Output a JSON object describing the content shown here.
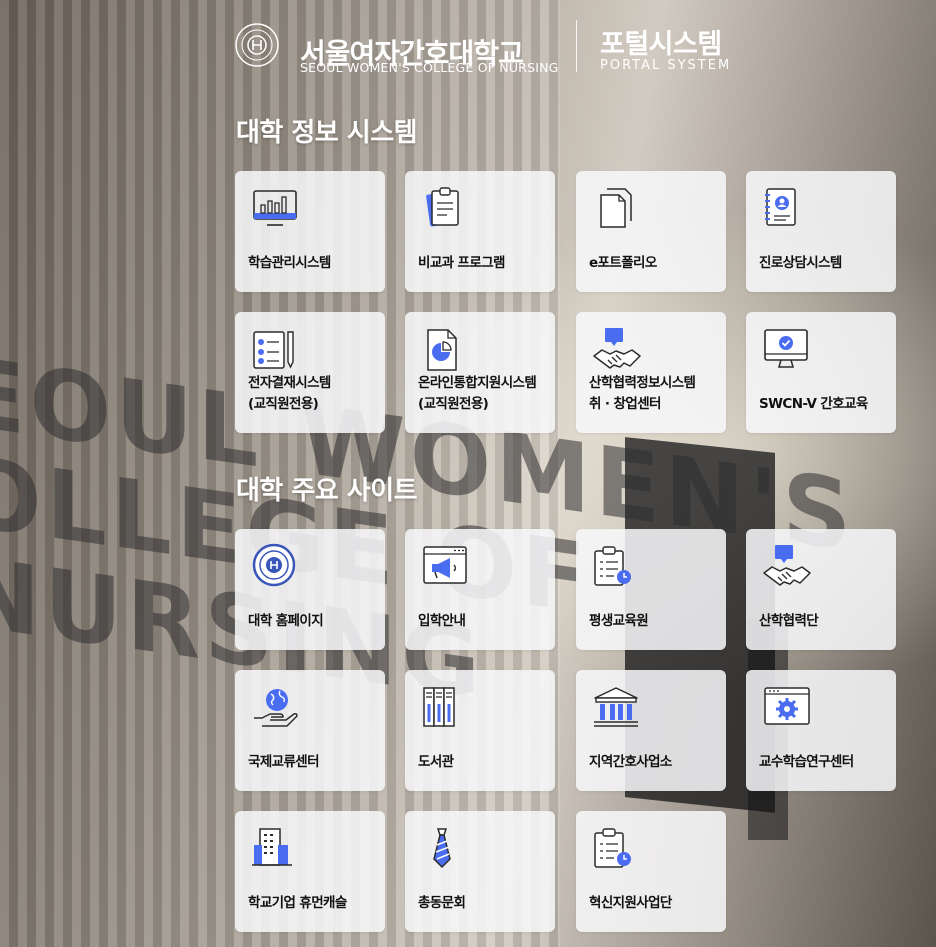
{
  "header": {
    "emblem_text": "SEOUL WOMEN'S COLLEGE OF NURSING 1936",
    "brand_ko": "서울여자간호대학교",
    "brand_en": "SEOUL WOMEN'S COLLEGE OF NURSING",
    "portal_ko": "포털시스템",
    "portal_en": "PORTAL SYSTEM"
  },
  "background": {
    "wall_lines": [
      "EOUL WOMEN'S",
      "OLLEGE OF NURSING"
    ]
  },
  "sections": [
    {
      "title": "대학 정보 시스템",
      "cards": [
        {
          "label": "학습관리시스템",
          "icon": "lms-monitor-icon"
        },
        {
          "label": "비교과 프로그램",
          "icon": "clipboard-icon"
        },
        {
          "label": "e포트폴리오",
          "icon": "documents-icon"
        },
        {
          "label": "진로상담시스템",
          "icon": "contact-book-icon"
        },
        {
          "label": "전자결재시스템\n(교직원전용)",
          "icon": "checklist-pen-icon"
        },
        {
          "label": "온라인통합지원시스템\n(교직원전용)",
          "icon": "report-chart-icon"
        },
        {
          "label": "산학협력정보시스템\n취 · 창업센터",
          "icon": "handshake-icon"
        },
        {
          "label": "SWCN-V 간호교육",
          "icon": "monitor-check-icon"
        }
      ]
    },
    {
      "title": "대학 주요 사이트",
      "cards": [
        {
          "label": "대학 홈페이지",
          "icon": "college-emblem-icon"
        },
        {
          "label": "입학안내",
          "icon": "megaphone-browser-icon"
        },
        {
          "label": "평생교육원",
          "icon": "clipboard-clock-icon"
        },
        {
          "label": "산학협력단",
          "icon": "handshake-icon"
        },
        {
          "label": "국제교류센터",
          "icon": "globe-hand-icon"
        },
        {
          "label": "도서관",
          "icon": "books-icon"
        },
        {
          "label": "지역간호사업소",
          "icon": "institution-icon"
        },
        {
          "label": "교수학습연구센터",
          "icon": "gear-browser-icon"
        },
        {
          "label": "학교기업 휴먼캐슬",
          "icon": "building-icon"
        },
        {
          "label": "총동문회",
          "icon": "necktie-icon"
        },
        {
          "label": "혁신지원사업단",
          "icon": "clipboard-clock-icon"
        }
      ]
    }
  ],
  "colors": {
    "accent": "#4a6cf0",
    "icon_stroke": "#2b2b2b"
  }
}
